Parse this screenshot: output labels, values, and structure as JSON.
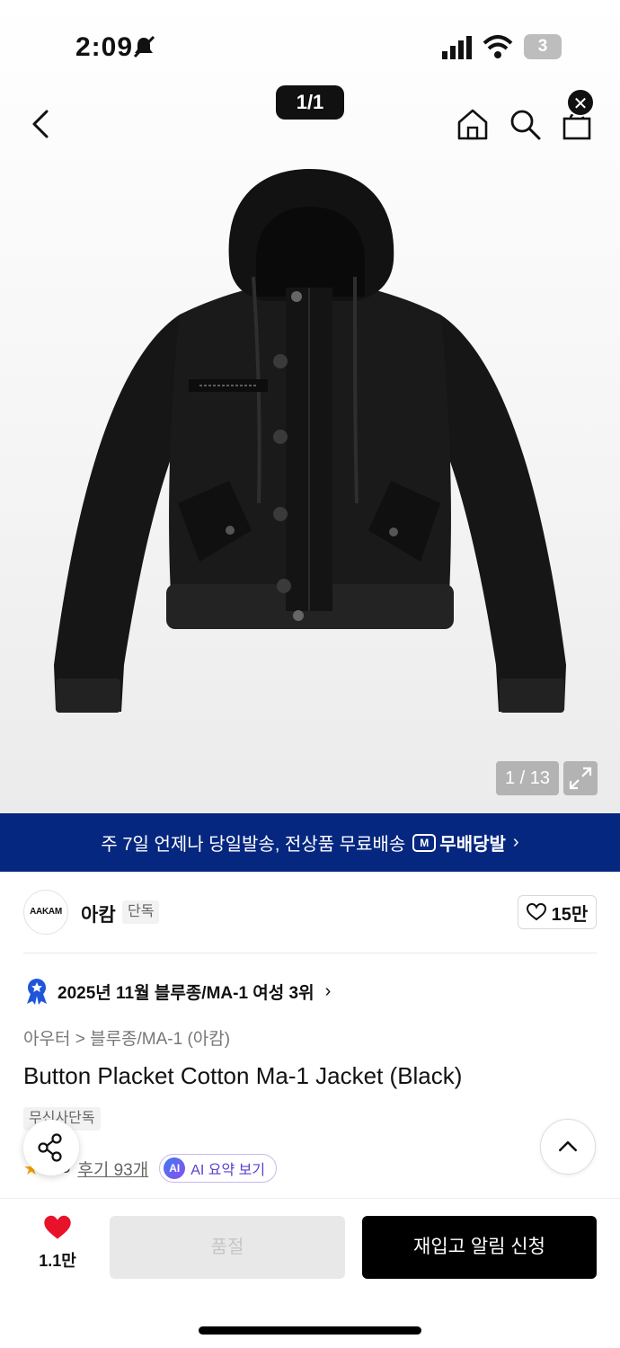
{
  "status_bar": {
    "time": "2:09",
    "battery": "3"
  },
  "header": {
    "page_indicator": "1/1"
  },
  "gallery": {
    "counter": "1 / 13"
  },
  "banner": {
    "text": "주 7일 언제나 당일발송, 전상품 무료배송",
    "logo_text": "무배당발",
    "logo_mark": "M"
  },
  "brand": {
    "logo_text": "AAKAM",
    "name": "아캄",
    "tag": "단독",
    "likes": "15만"
  },
  "ranking": {
    "text": "2025년 11월 블루종/MA-1 여성 3위"
  },
  "breadcrumb": {
    "text": "아우터 > 블루종/MA-1 (아캄)"
  },
  "product": {
    "title": "Button Placket Cotton Ma-1 Jacket (Black)",
    "exclusive_tag": "무신사단독"
  },
  "reviews": {
    "rating": "4.8",
    "review_link": "후기 93개",
    "ai_label": "AI 요약 보기",
    "ai_icon": "AI"
  },
  "bottom_bar": {
    "wish_count": "1.1만",
    "soldout_label": "품절",
    "restock_label": "재입고 알림 신청"
  },
  "colors": {
    "banner_bg": "#062780",
    "wish_heart": "#e8132a",
    "restock_bg": "#000000",
    "soldout_bg": "#e8e8e8"
  }
}
